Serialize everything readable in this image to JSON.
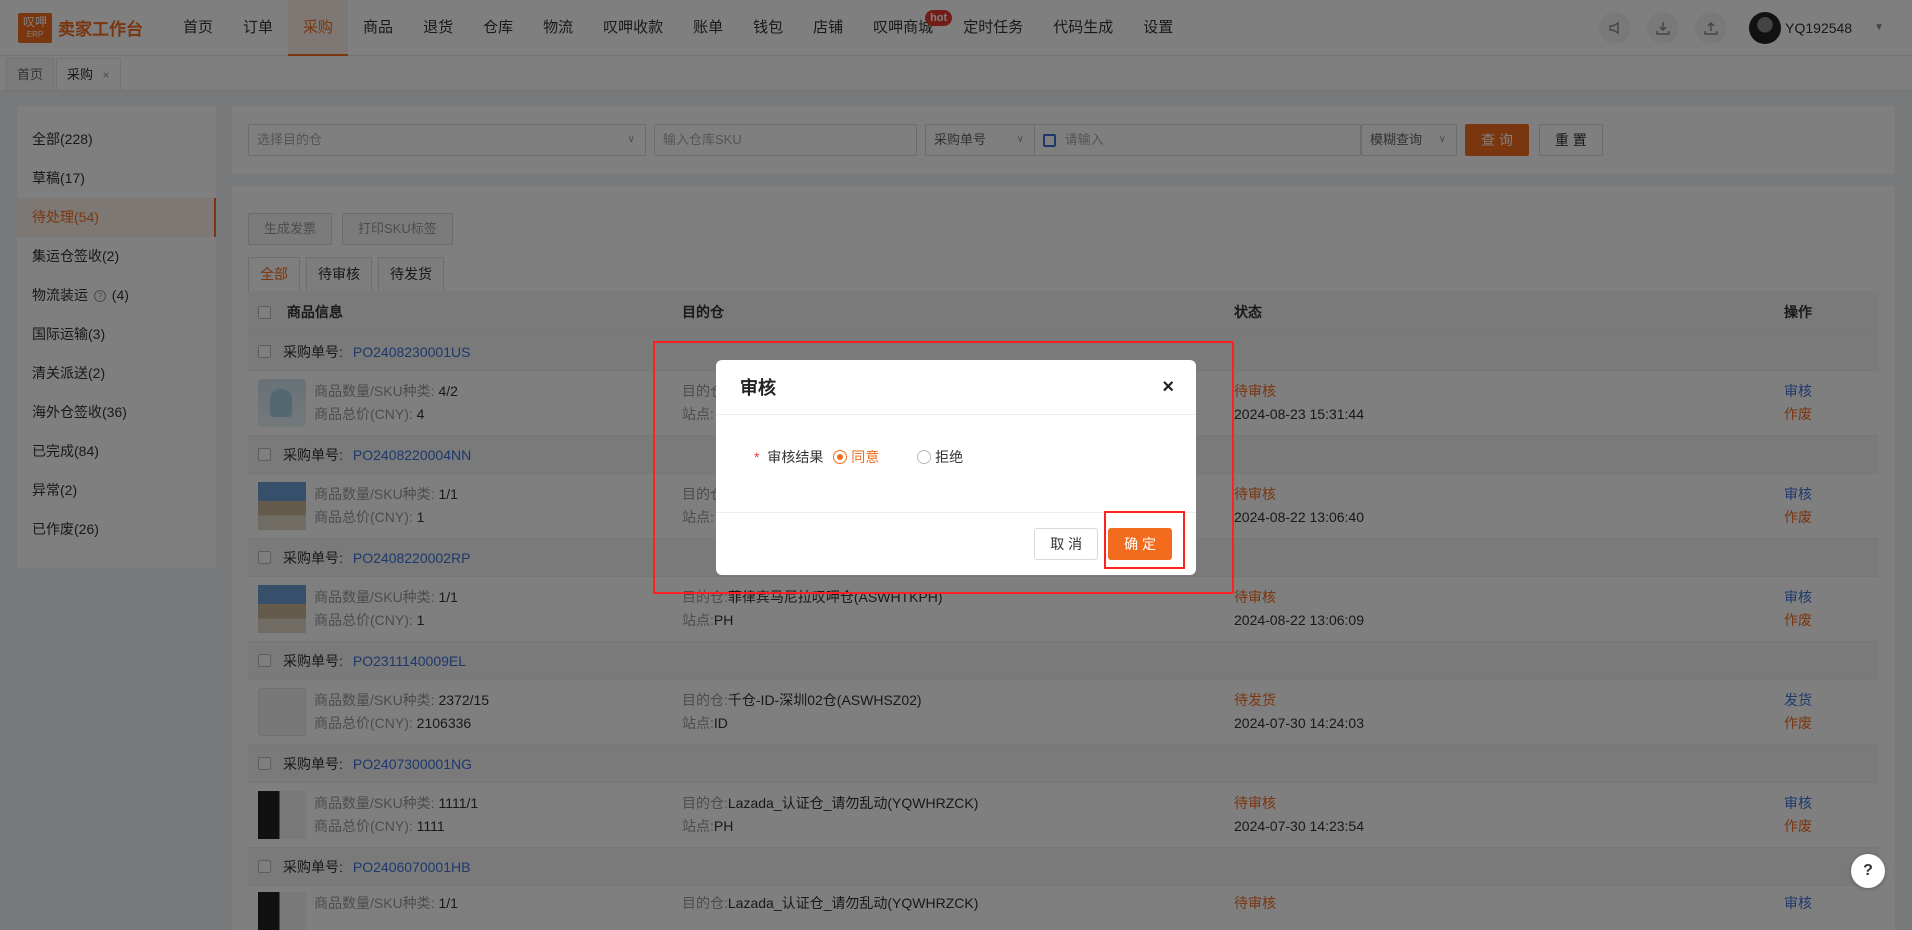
{
  "app": {
    "logo_top": "叹呷",
    "logo_bottom": "ERP",
    "title": "卖家工作台",
    "username": "YQ192548"
  },
  "nav": {
    "items": [
      {
        "label": "首页"
      },
      {
        "label": "订单"
      },
      {
        "label": "采购",
        "active": true
      },
      {
        "label": "商品"
      },
      {
        "label": "退货"
      },
      {
        "label": "仓库"
      },
      {
        "label": "物流"
      },
      {
        "label": "叹呷收款"
      },
      {
        "label": "账单"
      },
      {
        "label": "钱包"
      },
      {
        "label": "店铺"
      },
      {
        "label": "叹呷商城",
        "badge": "hot"
      },
      {
        "label": "定时任务"
      },
      {
        "label": "代码生成"
      },
      {
        "label": "设置"
      }
    ],
    "hot_badge": "hot"
  },
  "page_tabs": {
    "home": "首页",
    "purchase": "采购",
    "close": "×"
  },
  "sidemenu": {
    "items": [
      {
        "label": "全部(228)"
      },
      {
        "label": "草稿(17)"
      },
      {
        "label": "待处理(54)"
      },
      {
        "label": "集运仓签收(2)"
      },
      {
        "label": "物流装运",
        "count": "(4)"
      },
      {
        "label": "国际运输(3)"
      },
      {
        "label": "清关派送(2)"
      },
      {
        "label": "海外仓签收(36)"
      },
      {
        "label": "已完成(84)"
      },
      {
        "label": "异常(2)"
      },
      {
        "label": "已作废(26)"
      }
    ],
    "help_glyph": "?"
  },
  "filter": {
    "warehouse_placeholder": "选择目的仓",
    "sku_placeholder": "输入仓库SKU",
    "order_type": "采购单号",
    "keyword_placeholder": "请输入",
    "match_mode": "模糊查询",
    "search_label": "查 询",
    "reset_label": "重 置"
  },
  "actions": {
    "invoice": "生成发票",
    "print_sku": "打印SKU标签"
  },
  "status_tabs": {
    "all": "全部",
    "pending_review": "待审核",
    "pending_ship": "待发货"
  },
  "table": {
    "headers": {
      "goods": "商品信息",
      "warehouse": "目的仓",
      "status": "状态",
      "operation": "操作"
    },
    "po_label": "采购单号:",
    "qty_label": "商品数量/SKU种类:",
    "price_label": "商品总价(CNY):",
    "wh_label": "目的仓:",
    "site_label": "站点:",
    "rows": [
      {
        "po": "PO2408230001US",
        "qty": "4/2",
        "price": "4",
        "warehouse": "",
        "site": "",
        "status": "待审核",
        "time": "2024-08-23 15:31:44",
        "op": "审核",
        "void": "作废"
      },
      {
        "po": "PO2408220004NN",
        "qty": "1/1",
        "price": "1",
        "warehouse": "",
        "site": "",
        "status": "待审核",
        "time": "2024-08-22 13:06:40",
        "op": "审核",
        "void": "作废"
      },
      {
        "po": "PO2408220002RP",
        "qty": "1/1",
        "price": "1",
        "warehouse": "菲律宾马尼拉叹呷仓(ASWHTKPH)",
        "site": "PH",
        "status": "待审核",
        "time": "2024-08-22 13:06:09",
        "op": "审核",
        "void": "作废"
      },
      {
        "po": "PO2311140009EL",
        "qty": "2372/15",
        "price": "2106336",
        "warehouse": "千仓-ID-深圳02仓(ASWHSZ02)",
        "site": "ID",
        "status": "待发货",
        "time": "2024-07-30 14:24:03",
        "op": "发货",
        "void": "作废"
      },
      {
        "po": "PO2407300001NG",
        "qty": "1111/1",
        "price": "1111",
        "warehouse": "Lazada_认证仓_请勿乱动(YQWHRZCK)",
        "site": "PH",
        "status": "待审核",
        "time": "2024-07-30 14:23:54",
        "op": "审核",
        "void": "作废"
      },
      {
        "po": "PO2406070001HB",
        "qty": "1/1",
        "price": "",
        "warehouse": "Lazada_认证仓_请勿乱动(YQWHRZCK)",
        "site": "",
        "status": "待审核",
        "time": "",
        "op": "审核",
        "void": ""
      }
    ]
  },
  "modal": {
    "title": "审核",
    "close": "×",
    "field_required": "*",
    "field_label": "审核结果",
    "option_agree": "同意",
    "option_reject": "拒绝",
    "cancel_label": "取 消",
    "confirm_label": "确 定"
  },
  "help_fab": "?",
  "colors": {
    "accent": "#f36c1e",
    "link": "#3b73d9",
    "highlight": "#ff2020"
  }
}
